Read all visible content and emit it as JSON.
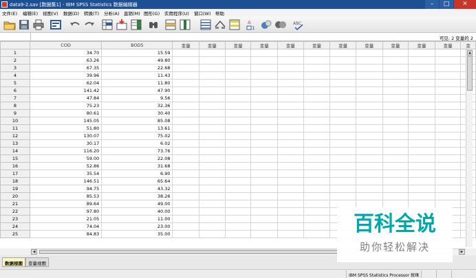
{
  "window": {
    "title": "data9-2.sav [数据集1] - IBM SPSS Statistics 数据编辑器",
    "minimize": "–",
    "maximize": "□",
    "close": "✕"
  },
  "menu": [
    "文件(E)",
    "编辑(E)",
    "视图(V)",
    "数据(D)",
    "转换(T)",
    "分析(A)",
    "直销(M)",
    "图形(G)",
    "实用程序(U)",
    "窗口(W)",
    "帮助"
  ],
  "toolbar_icons": [
    "open-folder-icon",
    "save-icon",
    "print-icon",
    "dialog-recall-icon",
    "undo-icon",
    "redo-icon",
    "goto-case-icon",
    "goto-variable-icon",
    "variables-icon",
    "find-icon",
    "insert-cases-icon",
    "insert-variable-icon",
    "split-file-icon",
    "weight-cases-icon",
    "select-cases-icon",
    "value-labels-icon",
    "use-sets-icon",
    "show-all-variables-icon",
    "spell-check-icon"
  ],
  "visible_info": "可见: 2 变量的 2",
  "columns": [
    "COD",
    "BOD5",
    "变量",
    "变量",
    "变量",
    "变量",
    "变量",
    "变量",
    "变量",
    "变量",
    "变量",
    "变量",
    "变量",
    "变"
  ],
  "rows": [
    [
      "1",
      "34.70",
      "15.59"
    ],
    [
      "2",
      "63.26",
      "49.80"
    ],
    [
      "3",
      "67.35",
      "22.68"
    ],
    [
      "4",
      "39.96",
      "11.43"
    ],
    [
      "5",
      "62.04",
      "11.80"
    ],
    [
      "6",
      "141.42",
      "47.90"
    ],
    [
      "7",
      "47.84",
      "9.56"
    ],
    [
      "8",
      "75.23",
      "32.36"
    ],
    [
      "9",
      "80.61",
      "30.40"
    ],
    [
      "10",
      "145.05",
      "85.08"
    ],
    [
      "11",
      "51.80",
      "13.61"
    ],
    [
      "12",
      "130.07",
      "75.02"
    ],
    [
      "13",
      "30.17",
      "6.02"
    ],
    [
      "14",
      "116.20",
      "73.76"
    ],
    [
      "15",
      "59.00",
      "22.08"
    ],
    [
      "16",
      "52.86",
      "31.68"
    ],
    [
      "17",
      "35.54",
      "6.90"
    ],
    [
      "18",
      "146.51",
      "65.64"
    ],
    [
      "19",
      "94.75",
      "43.32"
    ],
    [
      "20",
      "85.53",
      "38.26"
    ],
    [
      "21",
      "89.64",
      "49.00"
    ],
    [
      "22",
      "97.80",
      "40.00"
    ],
    [
      "23",
      "21.05",
      "11.00"
    ],
    [
      "24",
      "74.04",
      "23.00"
    ],
    [
      "25",
      "84.83",
      "35.00"
    ]
  ],
  "scroll": {
    "up": "▲",
    "left": "◀",
    "right": "▶"
  },
  "tabs": {
    "data_view": "数据视图",
    "variable_view": "变量视图"
  },
  "status": "IBM SPSS Statistics Processor 就绪",
  "watermark": {
    "main": "百科全说",
    "sub": "助你轻松解决"
  },
  "colors": {
    "titlebar": "#1c4f93",
    "close": "#c8352a",
    "active_tab": "#fff7c0",
    "watermark": "#00a9a8"
  }
}
